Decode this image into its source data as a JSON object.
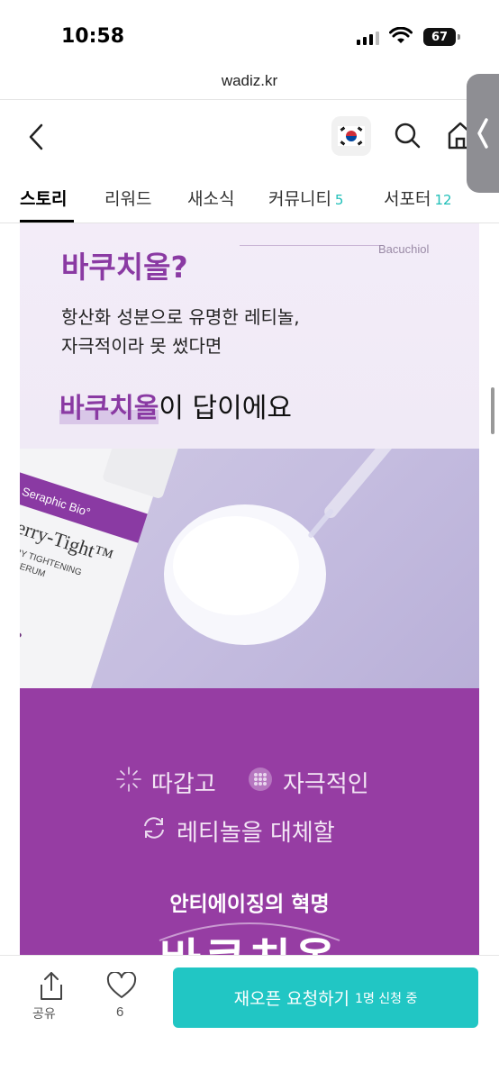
{
  "status_bar": {
    "time": "10:58",
    "battery": "67"
  },
  "browser": {
    "url": "wadiz.kr"
  },
  "header": {
    "flag_icon": "korea-flag-icon"
  },
  "tabs": [
    {
      "label": "스토리",
      "count": ""
    },
    {
      "label": "리워드",
      "count": ""
    },
    {
      "label": "새소식",
      "count": ""
    },
    {
      "label": "커뮤니티",
      "count": "5"
    },
    {
      "label": "서포터",
      "count": "12"
    }
  ],
  "story": {
    "title": "바쿠치올?",
    "title_en": "Bacuchiol",
    "desc_line1": "항산화 성분으로 유명한 레티놀,",
    "desc_line2": "자극적이라 못 썼다면",
    "answer_highlight": "바쿠치올",
    "answer_rest": "이 답이에요",
    "product_brand": "Seraphic Bio°",
    "product_name": "Berry-Tight™",
    "product_sub1": "BERRY TIGHTENING",
    "product_sub2": "AME SERUM",
    "feature1": "따갑고",
    "feature2": "자극적인",
    "feature3": "레티놀을 대체할",
    "anti_aging": "안티에이징의 혁명",
    "big_word": "바쿠치올"
  },
  "bottom_bar": {
    "share_label": "공유",
    "like_count": "6",
    "cta_label": "재오픈 요청하기",
    "cta_sub": "1명 신청 중"
  },
  "colors": {
    "accent_purple": "#8a3aa3",
    "cta_teal": "#21c6c4",
    "section_purple": "#963da3"
  }
}
